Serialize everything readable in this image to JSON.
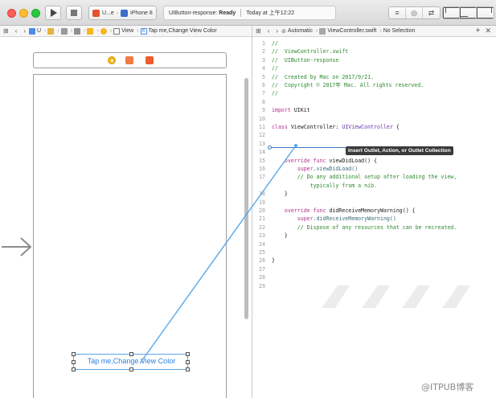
{
  "toolbar": {
    "scheme_target": "U...e",
    "scheme_device": "iPhone 8",
    "status_project": "UIButton-response:",
    "status_state": "Ready",
    "status_time": "Today at 上午12:22",
    "run_icon": "play-icon",
    "stop_icon": "stop-icon"
  },
  "left_jumpbar": {
    "crumbs": [
      "U",
      "",
      "",
      "",
      "",
      "",
      "View",
      "Tap me,Change View Color"
    ]
  },
  "right_jumpbar": {
    "mode": "Automatic",
    "file": "ViewController.swift",
    "selection": "No Selection"
  },
  "canvas": {
    "button_title": "Tap me,Change View Color"
  },
  "editor": {
    "tooltip": "Insert Outlet, Action, or Outlet Collection",
    "lines": [
      {
        "n": "1",
        "parts": [
          {
            "t": "//",
            "c": "comment"
          }
        ]
      },
      {
        "n": "2",
        "parts": [
          {
            "t": "//  ViewController.swift",
            "c": "comment"
          }
        ]
      },
      {
        "n": "3",
        "parts": [
          {
            "t": "//  UIButton-response",
            "c": "comment"
          }
        ]
      },
      {
        "n": "4",
        "parts": [
          {
            "t": "//",
            "c": "comment"
          }
        ]
      },
      {
        "n": "5",
        "parts": [
          {
            "t": "//  Created by Mac on 2017/9/21.",
            "c": "comment"
          }
        ]
      },
      {
        "n": "6",
        "parts": [
          {
            "t": "//  Copyright © 2017年 Mac. All rights reserved.",
            "c": "comment"
          }
        ]
      },
      {
        "n": "7",
        "parts": [
          {
            "t": "//",
            "c": "comment"
          }
        ]
      },
      {
        "n": "8",
        "parts": []
      },
      {
        "n": "9",
        "parts": [
          {
            "t": "import ",
            "c": "keyword"
          },
          {
            "t": "UIKit",
            "c": "plain"
          }
        ]
      },
      {
        "n": "10",
        "parts": []
      },
      {
        "n": "11",
        "parts": [
          {
            "t": "class ",
            "c": "keyword"
          },
          {
            "t": "ViewController: ",
            "c": "plain"
          },
          {
            "t": "UIViewController",
            "c": "type"
          },
          {
            "t": " {",
            "c": "plain"
          }
        ]
      },
      {
        "n": "12",
        "parts": []
      },
      {
        "n": "13",
        "parts": []
      },
      {
        "n": "14",
        "parts": []
      },
      {
        "n": "15",
        "parts": [
          {
            "t": "    override func ",
            "c": "keyword"
          },
          {
            "t": "viewDidLoad() {",
            "c": "plain"
          }
        ]
      },
      {
        "n": "16",
        "parts": [
          {
            "t": "        super",
            "c": "keyword"
          },
          {
            "t": ".viewDidLoad()",
            "c": "method"
          }
        ]
      },
      {
        "n": "17",
        "parts": [
          {
            "t": "        // Do any additional setup after loading the view,",
            "c": "comment"
          }
        ]
      },
      {
        "n": "",
        "parts": [
          {
            "t": "            typically from a nib.",
            "c": "comment"
          }
        ]
      },
      {
        "n": "18",
        "parts": [
          {
            "t": "    }",
            "c": "plain"
          }
        ]
      },
      {
        "n": "19",
        "parts": []
      },
      {
        "n": "20",
        "parts": [
          {
            "t": "    override func ",
            "c": "keyword"
          },
          {
            "t": "didReceiveMemoryWarning() {",
            "c": "plain"
          }
        ]
      },
      {
        "n": "21",
        "parts": [
          {
            "t": "        super",
            "c": "keyword"
          },
          {
            "t": ".didReceiveMemoryWarning()",
            "c": "method"
          }
        ]
      },
      {
        "n": "22",
        "parts": [
          {
            "t": "        // Dispose of any resources that can be recreated.",
            "c": "comment"
          }
        ]
      },
      {
        "n": "23",
        "parts": [
          {
            "t": "    }",
            "c": "plain"
          }
        ]
      },
      {
        "n": "24",
        "parts": []
      },
      {
        "n": "25",
        "parts": []
      },
      {
        "n": "26",
        "parts": [
          {
            "t": "}",
            "c": "plain"
          }
        ]
      },
      {
        "n": "27",
        "parts": []
      },
      {
        "n": "28",
        "parts": []
      },
      {
        "n": "29",
        "parts": []
      }
    ]
  },
  "watermark": "@ITPUB博客",
  "colors": {
    "comment": "#2c8a2c",
    "keyword": "#b4308d",
    "type": "#6a36a9",
    "connection": "#5aa7e8"
  }
}
